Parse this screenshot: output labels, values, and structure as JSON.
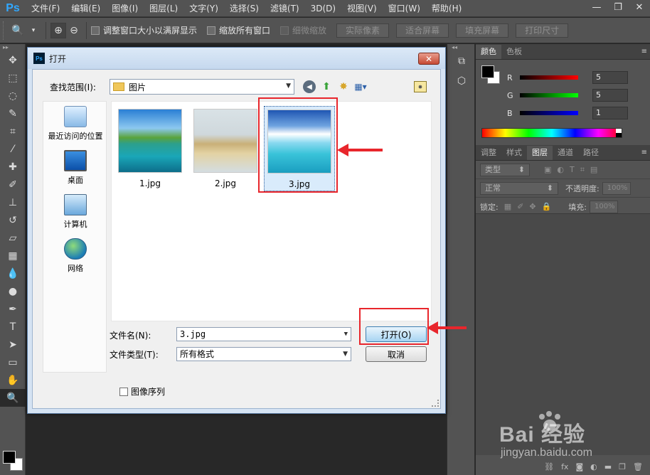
{
  "app": {
    "logo": "Ps",
    "menus": [
      "文件(F)",
      "编辑(E)",
      "图像(I)",
      "图层(L)",
      "文字(Y)",
      "选择(S)",
      "滤镜(T)",
      "3D(D)",
      "视图(V)",
      "窗口(W)",
      "帮助(H)"
    ],
    "window_controls": {
      "minimize": "—",
      "restore": "❐",
      "close": "✕"
    }
  },
  "options_bar": {
    "checkboxes": [
      {
        "label": "调整窗口大小以满屏显示",
        "enabled": true
      },
      {
        "label": "缩放所有窗口",
        "enabled": true
      },
      {
        "label": "细微缩放",
        "enabled": false
      }
    ],
    "buttons": [
      "实际像素",
      "适合屏幕",
      "填充屏幕",
      "打印尺寸"
    ]
  },
  "color_panel": {
    "tabs": [
      "颜色",
      "色板"
    ],
    "channels": [
      {
        "label": "R",
        "value": "5",
        "color": "#d42020"
      },
      {
        "label": "G",
        "value": "5",
        "color": "#23c023"
      },
      {
        "label": "B",
        "value": "1",
        "color": "#1a2fd4"
      }
    ]
  },
  "layers_panel": {
    "tabs": [
      "调整",
      "样式",
      "图层",
      "通道",
      "路径"
    ],
    "active_tab": "图层",
    "filter_label": "类型",
    "blend_mode": "正常",
    "opacity_label": "不透明度:",
    "opacity_value": "100%",
    "lock_label": "锁定:",
    "fill_label": "填充:",
    "fill_value": "100%"
  },
  "dialog": {
    "title": "打开",
    "look_in_label": "查找范围(I):",
    "look_in_value": "图片",
    "places": [
      {
        "label": "最近访问的位置",
        "icon": "recent-places-icon"
      },
      {
        "label": "桌面",
        "icon": "desktop-icon"
      },
      {
        "label": "计算机",
        "icon": "computer-icon"
      },
      {
        "label": "网络",
        "icon": "network-icon"
      }
    ],
    "files": [
      {
        "name": "1.jpg",
        "selected": false
      },
      {
        "name": "2.jpg",
        "selected": false
      },
      {
        "name": "3.jpg",
        "selected": true
      }
    ],
    "filename_label": "文件名(N):",
    "filename_value": "3.jpg",
    "filetype_label": "文件类型(T):",
    "filetype_value": "所有格式",
    "open_button": "打开(O)",
    "cancel_button": "取消",
    "image_sequence_label": "图像序列"
  },
  "watermark": {
    "brand": "Bai 经验",
    "url": "jingyan.baidu.com"
  },
  "colors": {
    "accent_red": "#e8262c",
    "ps_blue": "#31a8ff"
  }
}
